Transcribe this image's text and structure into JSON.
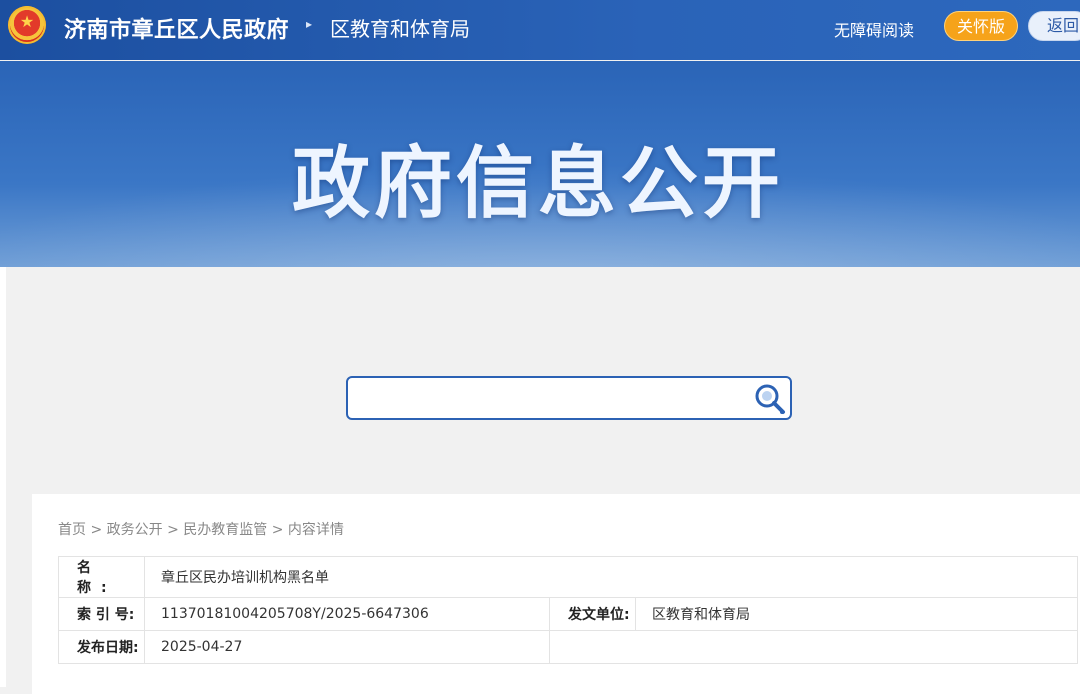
{
  "header": {
    "site_title": "济南市章丘区人民政府",
    "arrow": "▸",
    "dept_title": "区教育和体育局",
    "accessible_reading": "无障碍阅读",
    "care_mode": "关怀版",
    "back": "返回"
  },
  "banner": {
    "title": "政府信息公开"
  },
  "search": {
    "value": "",
    "placeholder": ""
  },
  "breadcrumb": {
    "items": [
      "首页",
      "政务公开",
      "民办教育监管",
      "内容详情"
    ],
    "separator": ">"
  },
  "info": {
    "name_label": "名 称:",
    "name_value": "章丘区民办培训机构黑名单",
    "index_label": "索 引 号:",
    "index_value": "11370181004205708Y/2025-6647306",
    "issuer_label": "发文单位:",
    "issuer_value": "区教育和体育局",
    "date_label": "发布日期:",
    "date_value": "2025-04-27"
  },
  "colors": {
    "header_blue": "#1c4fa0",
    "accent_orange": "#f6a31a",
    "search_border": "#2c62b4"
  }
}
